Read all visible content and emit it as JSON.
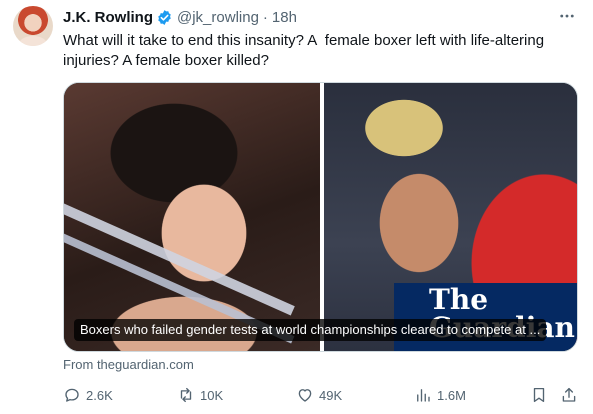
{
  "tweet": {
    "author_name": "J.K. Rowling",
    "handle": "@jk_rowling",
    "separator": "·",
    "time": "18h",
    "text": "What will it take to end this insanity? A  female boxer left with life-altering injuries? A female boxer killed?",
    "verified_color": "#1d9bf0"
  },
  "card": {
    "watermark": "The\nGuardian",
    "caption": "Boxers who failed gender tests at world championships cleared to compete at ...",
    "source": "From theguardian.com"
  },
  "actions": {
    "replies": "2.6K",
    "reposts": "10K",
    "likes": "49K",
    "views": "1.6M"
  },
  "icons": [
    "more-icon",
    "verified-icon",
    "reply-icon",
    "repost-icon",
    "like-icon",
    "views-icon",
    "bookmark-icon",
    "share-icon"
  ]
}
